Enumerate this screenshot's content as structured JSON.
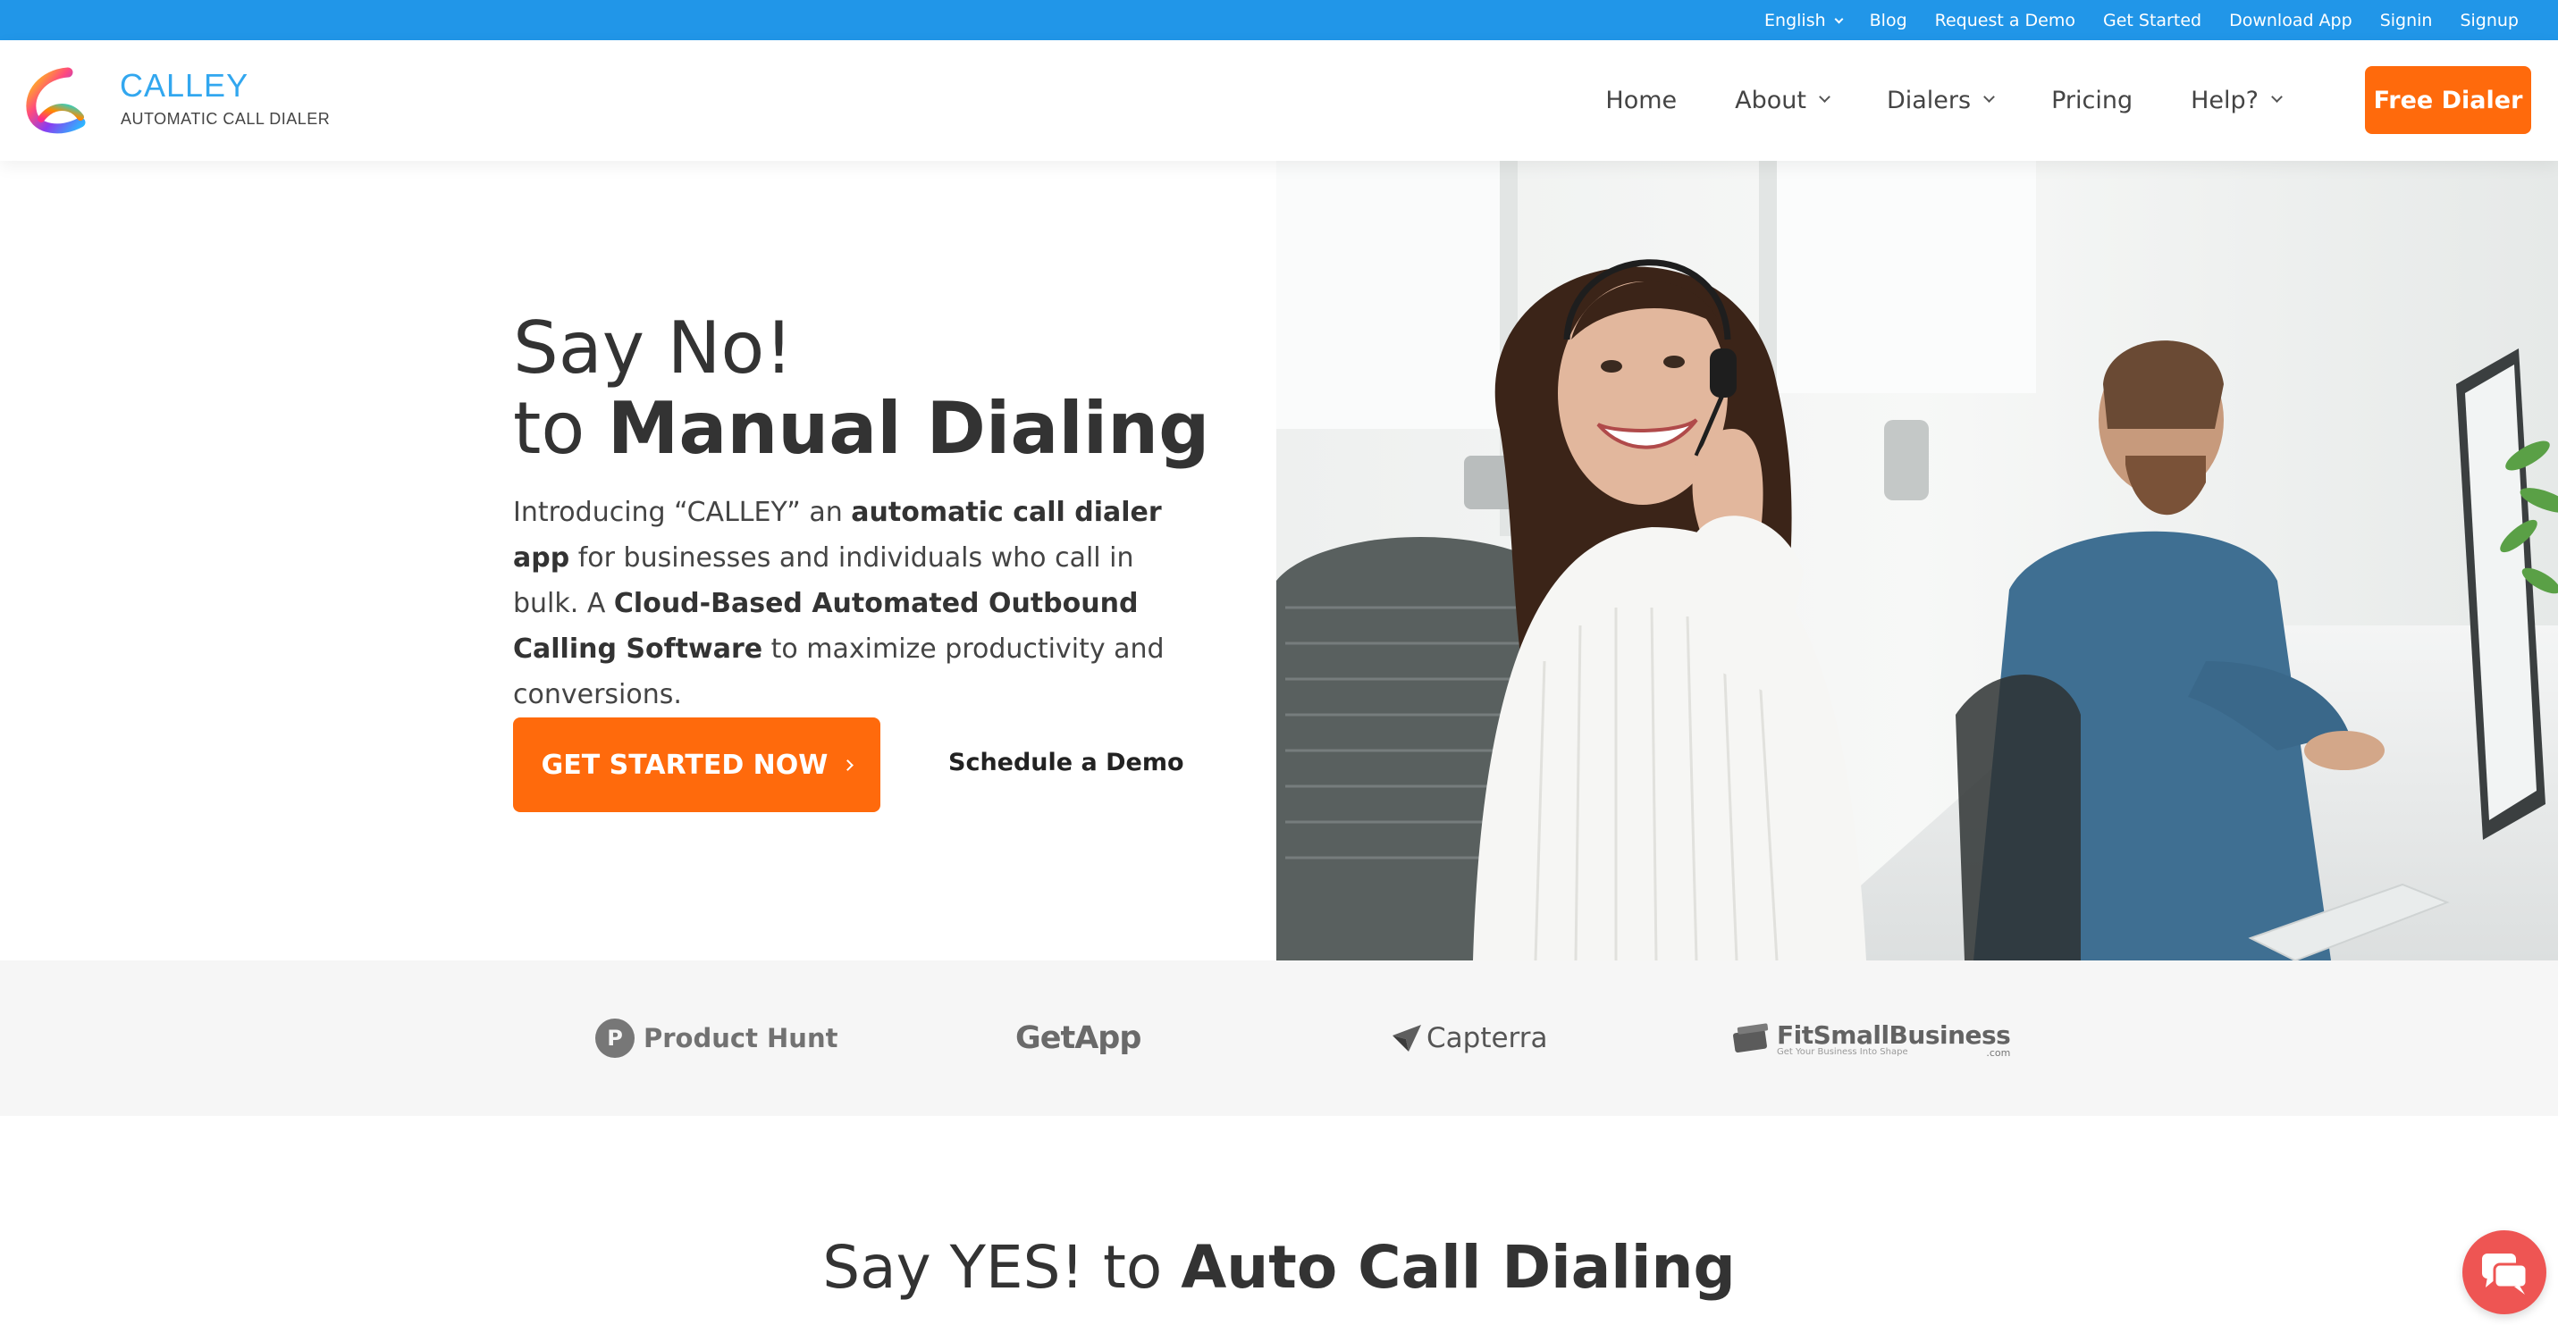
{
  "topbar": {
    "language": "English",
    "links": [
      "Blog",
      "Request a Demo",
      "Get Started",
      "Download App",
      "Signin",
      "Signup"
    ]
  },
  "brand": {
    "name": "CALLEY",
    "tagline": "AUTOMATIC CALL DIALER"
  },
  "nav": {
    "home": "Home",
    "about": "About",
    "dialers": "Dialers",
    "pricing": "Pricing",
    "help": "Help?",
    "cta": "Free Dialer"
  },
  "hero": {
    "line1": "Say No!",
    "line2_prefix": "to ",
    "line2_bold": "Manual Dialing",
    "intro_1": "Introducing “CALLEY” an ",
    "intro_2_bold": "automatic call dialer app",
    "intro_3": " for businesses and individuals who call in bulk. A ",
    "intro_4_bold": "Cloud-Based Automated Outbound Calling Software",
    "intro_5": " to maximize productivity and conversions.",
    "cta": "GET STARTED NOW",
    "demo": "Schedule a Demo"
  },
  "review_logos": {
    "producthunt_mark": "P",
    "producthunt": "Product Hunt",
    "getapp": "GetApp",
    "capterra": "Capterra",
    "fitsmall": "FitSmallBusiness",
    "fitsmall_sub": "Get Your Business Into Shape",
    "fitsmall_com": ".com"
  },
  "section2": {
    "prefix": "Say YES! to ",
    "bold": "Auto Call Dialing"
  },
  "colors": {
    "topbar": "#2196e8",
    "accent": "#ff6a0c",
    "brand": "#32a7ef",
    "chat": "#ee5553"
  },
  "icons": [
    "chevron-down-icon",
    "chevron-right-icon",
    "calley-logo",
    "chat-icon",
    "capterra-arrow-icon",
    "fitsmallbusiness-icon"
  ]
}
